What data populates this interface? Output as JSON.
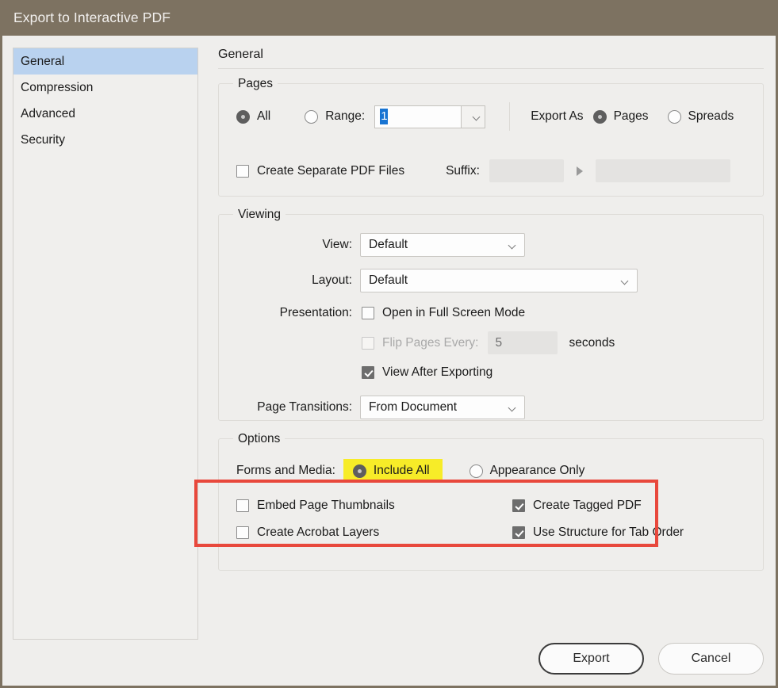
{
  "window": {
    "title": "Export to Interactive PDF",
    "title_bar_color": "#7d7261",
    "background_color": "#efeeec"
  },
  "sidebar": {
    "items": [
      {
        "label": "General",
        "selected": true
      },
      {
        "label": "Compression",
        "selected": false
      },
      {
        "label": "Advanced",
        "selected": false
      },
      {
        "label": "Security",
        "selected": false
      }
    ],
    "selected_color": "#b9d2ef"
  },
  "pane": {
    "title": "General"
  },
  "pages_group": {
    "legend": "Pages",
    "all_label": "All",
    "all_selected": true,
    "range_label": "Range:",
    "range_value": "1",
    "range_selected": false,
    "export_as_label": "Export As",
    "export_as_pages_label": "Pages",
    "export_as_pages_selected": true,
    "export_as_spreads_label": "Spreads",
    "export_as_spreads_selected": false,
    "create_separate_label": "Create Separate PDF Files",
    "create_separate_checked": false,
    "suffix_label": "Suffix:",
    "suffix_value_1": "",
    "suffix_value_2": ""
  },
  "viewing_group": {
    "legend": "Viewing",
    "view_label": "View:",
    "view_value": "Default",
    "layout_label": "Layout:",
    "layout_value": "Default",
    "presentation_label": "Presentation:",
    "fullscreen_label": "Open in Full Screen Mode",
    "fullscreen_checked": false,
    "flip_pages_label": "Flip Pages Every:",
    "flip_pages_checked": false,
    "flip_pages_disabled": true,
    "flip_seconds_value": "5",
    "seconds_label": "seconds",
    "view_after_export_label": "View After Exporting",
    "view_after_export_checked": true,
    "page_transitions_label": "Page Transitions:",
    "page_transitions_value": "From Document"
  },
  "options_group": {
    "legend": "Options",
    "forms_media_label": "Forms and Media:",
    "include_all_label": "Include All",
    "include_all_selected": true,
    "include_all_highlight_color": "#f7ec28",
    "appearance_only_label": "Appearance Only",
    "appearance_only_selected": false,
    "embed_thumbnails_label": "Embed Page Thumbnails",
    "embed_thumbnails_checked": false,
    "create_tagged_label": "Create Tagged PDF",
    "create_tagged_checked": true,
    "acrobat_layers_label": "Create Acrobat Layers",
    "acrobat_layers_checked": false,
    "tab_order_label": "Use Structure for Tab Order",
    "tab_order_checked": true
  },
  "annotation": {
    "highlight_box_color": "#e8483c"
  },
  "footer": {
    "export_label": "Export",
    "cancel_label": "Cancel"
  }
}
